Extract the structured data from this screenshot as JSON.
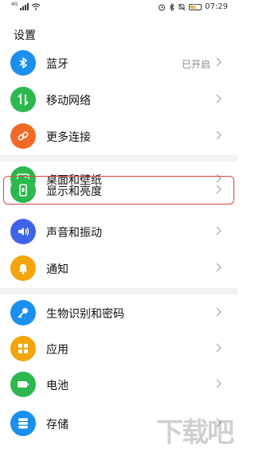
{
  "status_bar": {
    "left_text": "4G",
    "battery_level": "30",
    "time": "07:29",
    "icons": [
      "signal-icon",
      "wifi-icon",
      "alarm-icon",
      "bluetooth-icon",
      "mute-icon",
      "battery-icon"
    ]
  },
  "page": {
    "title": "设置"
  },
  "items": [
    {
      "label": "蓝牙",
      "value": "已开启",
      "icon": "bluetooth-icon",
      "color": "#1a8ff0"
    },
    {
      "label": "移动网络",
      "value": "",
      "icon": "mobile-data-icon",
      "color": "#2db84f"
    },
    {
      "label": "更多连接",
      "value": "",
      "icon": "link-icon",
      "color": "#f06a26"
    },
    {
      "label": "桌面和壁纸",
      "value": "",
      "icon": "wallpaper-icon",
      "color": "#2db84f"
    },
    {
      "label": "显示和亮度",
      "value": "",
      "icon": "display-icon",
      "color": "#2db84f"
    },
    {
      "label": "声音和振动",
      "value": "",
      "icon": "sound-icon",
      "color": "#3f63e8"
    },
    {
      "label": "通知",
      "value": "",
      "icon": "notification-icon",
      "color": "#f2a50c"
    },
    {
      "label": "生物识别和密码",
      "value": "",
      "icon": "key-icon",
      "color": "#1a8ff0"
    },
    {
      "label": "应用",
      "value": "",
      "icon": "apps-icon",
      "color": "#f2a50c"
    },
    {
      "label": "电池",
      "value": "",
      "icon": "battery-icon",
      "color": "#2db84f"
    },
    {
      "label": "存储",
      "value": "",
      "icon": "storage-icon",
      "color": "#1a8ff0"
    }
  ],
  "highlight_color": "#d9453a",
  "watermark": "下载吧"
}
